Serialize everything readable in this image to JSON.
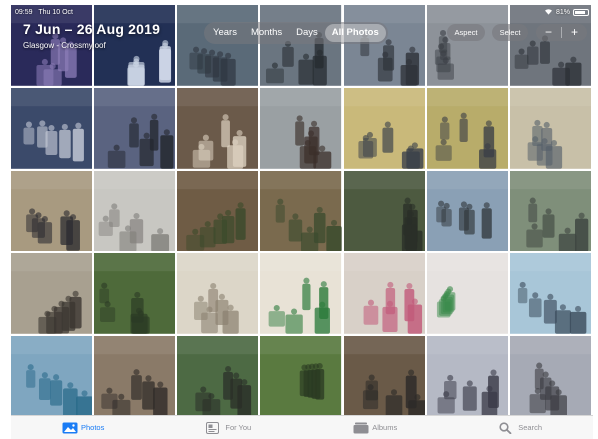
{
  "status_bar": {
    "time": "09:59",
    "date": "Thu 10 Oct",
    "battery_text": "81%",
    "battery_level": 0.81
  },
  "header": {
    "date_range": "7 Jun – 26 Aug 2019",
    "location": "Glasgow - Crossmyloof"
  },
  "view_switcher": {
    "items": [
      {
        "label": "Years",
        "active": false
      },
      {
        "label": "Months",
        "active": false
      },
      {
        "label": "Days",
        "active": false
      },
      {
        "label": "All Photos",
        "active": true
      }
    ]
  },
  "toolbar": {
    "aspect_label": "Aspect",
    "select_label": "Select",
    "zoom_out": "−",
    "zoom_in": "+"
  },
  "photos": [
    {
      "name": "photo-presentation-stage",
      "bg": "#2a2a5a",
      "fg": "#8a7bb6"
    },
    {
      "name": "photo-projector-screen",
      "bg": "#223055",
      "fg": "#cfd8e8"
    },
    {
      "name": "photo-classroom-students",
      "bg": "#5a6a78",
      "fg": "#2e3640"
    },
    {
      "name": "photo-students-at-desk",
      "bg": "#6a7580",
      "fg": "#262b30"
    },
    {
      "name": "photo-classroom-presentation",
      "bg": "#7b8694",
      "fg": "#2e3238"
    },
    {
      "name": "photo-students-group",
      "bg": "#8d9299",
      "fg": "#3a3e44"
    },
    {
      "name": "photo-teacher-classroom",
      "bg": "#6f757d",
      "fg": "#2b2f36"
    },
    {
      "name": "photo-assembly-hall",
      "bg": "#3b4a6a",
      "fg": "#c7ccd8"
    },
    {
      "name": "photo-hall-audience",
      "bg": "#5a6380",
      "fg": "#24282f"
    },
    {
      "name": "photo-speaker-podium",
      "bg": "#6b5a4a",
      "fg": "#dcd1c0"
    },
    {
      "name": "photo-student-whiteboard",
      "bg": "#9aa0a3",
      "fg": "#3b2f2a"
    },
    {
      "name": "photo-smartboard-lesson",
      "bg": "#c9b97a",
      "fg": "#39404a"
    },
    {
      "name": "photo-class-smartboard",
      "bg": "#b8ac6a",
      "fg": "#3a3e46"
    },
    {
      "name": "photo-cup-on-table",
      "bg": "#c8c0a8",
      "fg": "#55606a"
    },
    {
      "name": "photo-desk-worksheet",
      "bg": "#a89a80",
      "fg": "#2b2b30"
    },
    {
      "name": "photo-poster-paper",
      "bg": "#c8c7c2",
      "fg": "#7f7d79"
    },
    {
      "name": "photo-garden-canes",
      "bg": "#6f5c45",
      "fg": "#3a4a2a"
    },
    {
      "name": "photo-students-gardening",
      "bg": "#7a6a4e",
      "fg": "#3b4b2e"
    },
    {
      "name": "photo-garden-group",
      "bg": "#4d5a40",
      "fg": "#2a2f28"
    },
    {
      "name": "photo-school-building",
      "bg": "#8aa0b5",
      "fg": "#30363a"
    },
    {
      "name": "photo-school-path",
      "bg": "#7f8f7a",
      "fg": "#3e4540"
    },
    {
      "name": "photo-classroom-desks",
      "bg": "#a8a090",
      "fg": "#3a3530"
    },
    {
      "name": "photo-park-river",
      "bg": "#4e6a3a",
      "fg": "#2b3a25"
    },
    {
      "name": "photo-written-notes",
      "bg": "#dcd6c8",
      "fg": "#8a8070"
    },
    {
      "name": "photo-poster-green-title",
      "bg": "#e8e2d6",
      "fg": "#2a7a3a"
    },
    {
      "name": "photo-poster-pages",
      "bg": "#d8d0c8",
      "fg": "#c25a7a"
    },
    {
      "name": "photo-poster-liberty-ny",
      "bg": "#e6e2e0",
      "fg": "#3a8a4a"
    },
    {
      "name": "photo-students-certificates",
      "bg": "#a8c6d8",
      "fg": "#3a4a5a"
    },
    {
      "name": "photo-students-outdoors-row",
      "bg": "#7fa6c0",
      "fg": "#2a6a8a"
    },
    {
      "name": "photo-music-cello",
      "bg": "#8a7a68",
      "fg": "#2e2a28"
    },
    {
      "name": "photo-outdoor-musicians",
      "bg": "#4d6a44",
      "fg": "#2a2e28"
    },
    {
      "name": "photo-garden-performance",
      "bg": "#5a7a40",
      "fg": "#2a3a22"
    },
    {
      "name": "photo-band-outdoors",
      "bg": "#6a5a48",
      "fg": "#2c2a28"
    },
    {
      "name": "photo-award-event",
      "bg": "#b5b9c5",
      "fg": "#3a3a48"
    },
    {
      "name": "photo-presentation-audience",
      "bg": "#a6aab5",
      "fg": "#3a3a40"
    }
  ],
  "tab_bar": {
    "tabs": [
      {
        "label": "Photos",
        "icon": "photos-icon",
        "active": true
      },
      {
        "label": "For You",
        "icon": "for-you-icon",
        "active": false
      },
      {
        "label": "Albums",
        "icon": "albums-icon",
        "active": false
      },
      {
        "label": "Search",
        "icon": "search-icon",
        "active": false
      }
    ]
  },
  "colors": {
    "accent": "#1a7cf5",
    "inactive": "#8e8e93"
  }
}
